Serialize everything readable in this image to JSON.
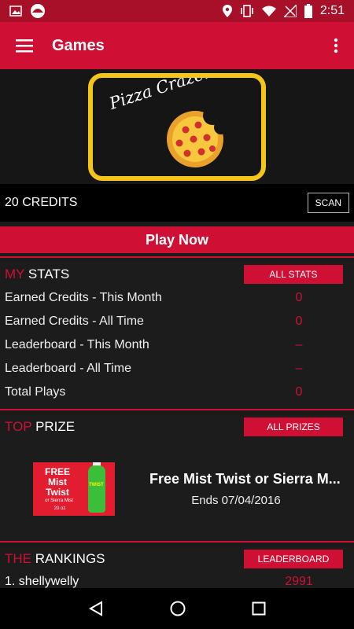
{
  "status_bar": {
    "time": "2:51"
  },
  "app_bar": {
    "title": "Games"
  },
  "banner": {
    "title": "Pizza Craze!"
  },
  "credits": {
    "label": "20 CREDITS",
    "scan_label": "SCAN"
  },
  "play_now": "Play Now",
  "stats": {
    "title_accent": "MY",
    "title_rest": " STATS",
    "button": "ALL STATS",
    "rows": [
      {
        "label": "Earned Credits - This Month",
        "value": "0"
      },
      {
        "label": "Earned Credits - All Time",
        "value": "0"
      },
      {
        "label": "Leaderboard - This Month",
        "value": "–"
      },
      {
        "label": "Leaderboard - All Time",
        "value": "–"
      },
      {
        "label": "Total Plays",
        "value": "0"
      }
    ]
  },
  "prize": {
    "title_accent": "TOP",
    "title_rest": " PRIZE",
    "button": "ALL PRIZES",
    "name": "Free Mist Twist or Sierra M...",
    "ends": "Ends 07/04/2016",
    "image_text": "FREE Mist Twist",
    "image_subtext": "or Sierra Mist",
    "image_size": "20 oz",
    "bottle_label": "TWIST"
  },
  "rankings": {
    "title_accent": "THE",
    "title_rest": " RANKINGS",
    "button": "LEADERBOARD",
    "rows": [
      {
        "name": "1. shellywelly",
        "score": "2991"
      }
    ]
  },
  "colors": {
    "accent": "#cf1034",
    "banner_border": "#f5c518"
  }
}
